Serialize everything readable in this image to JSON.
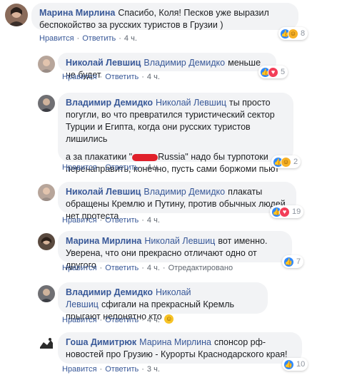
{
  "comments": [
    {
      "author": "Марина Мирлина",
      "text": "Спасибо, Коля! Песков уже выразил беспокойство за русских туристов в Грузии )",
      "actions": {
        "like": "Нравится",
        "reply": "Ответить",
        "time": "4 ч."
      },
      "reactions": {
        "count": "8",
        "icons": [
          "like",
          "haha"
        ]
      }
    },
    {
      "author": "Николай Левшиц",
      "mention": "Владимир Демидко",
      "text": "меньше не будет",
      "actions": {
        "like": "Нравится",
        "reply": "Ответить",
        "time": "4 ч."
      },
      "reactions": {
        "count": "5",
        "icons": [
          "like",
          "heart"
        ]
      }
    },
    {
      "author": "Владимир Демидко",
      "mention": "Николай Левшиц",
      "text": "ты просто погугли, во что превратился туристический сектор Турции и Египта, когда они русских туристов лишились",
      "text2_pre": "а за плакатики \"",
      "text2_post": "Russia\" надо бы турпотоки перенаправить, конечно, пусть сами боржоми пьют",
      "actions": {
        "like": "Нравится",
        "reply": "Ответить",
        "time": "4 ч."
      },
      "reactions": {
        "count": "2",
        "icons": [
          "like",
          "haha"
        ]
      }
    },
    {
      "author": "Николай Левшиц",
      "mention": "Владимир Демидко",
      "text": "плакаты обращены Кремлю и Путину, против обычных людей нет протеста",
      "actions": {
        "like": "Нравится",
        "reply": "Ответить",
        "time": "4 ч."
      },
      "reactions": {
        "count": "19",
        "icons": [
          "like",
          "heart"
        ]
      }
    },
    {
      "author": "Марина Мирлина",
      "mention": "Николай Левшиц",
      "text": "вот именно. Уверена, что они прекрасно отличают одно от другого",
      "actions": {
        "like": "Нравится",
        "reply": "Ответить",
        "time": "4 ч.",
        "edited": "Отредактировано"
      },
      "reactions": {
        "count": "7",
        "icons": [
          "like"
        ]
      }
    },
    {
      "author": "Владимир Демидко",
      "mention": "Николай Левшиц",
      "text": "сфигали на прекрасный Кремль прыгают непонятно кто",
      "actions": {
        "like": "Нравится",
        "reply": "Ответить",
        "time": "4 ч."
      },
      "reactions": {
        "count": "",
        "icons": []
      }
    },
    {
      "author": "Гоша Димитрюк",
      "mention": "Марина Мирлина",
      "text": "спонсор рф-новостей про Грузию - Курорты Краснодарского края!",
      "actions": {
        "like": "Нравится",
        "reply": "Ответить",
        "time": "3 ч."
      },
      "reactions": {
        "count": "10",
        "icons": [
          "like"
        ]
      }
    }
  ],
  "colors": {
    "link": "#385898",
    "bubble": "#f2f3f5",
    "meta": "#606770"
  }
}
